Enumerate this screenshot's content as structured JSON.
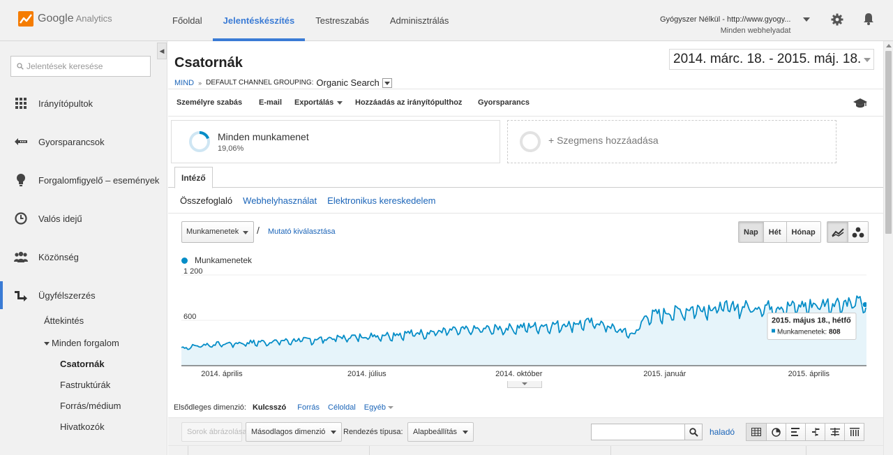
{
  "app": {
    "logo_google": "Google",
    "logo_product": "Analytics"
  },
  "nav": {
    "tabs": [
      {
        "label": "Főoldal",
        "active": false
      },
      {
        "label": "Jelentéskészítés",
        "active": true
      },
      {
        "label": "Testreszabás",
        "active": false
      },
      {
        "label": "Adminisztrálás",
        "active": false
      }
    ]
  },
  "account": {
    "property": "Gyógyszer Nélkül - http://www.gyogy...",
    "view": "Minden webhelyadat"
  },
  "sidebar": {
    "search_placeholder": "Jelentések keresése",
    "items": [
      {
        "label": "Irányítópultok",
        "icon": "grid-icon"
      },
      {
        "label": "Gyorsparancsok",
        "icon": "shortcut-arrow-icon"
      },
      {
        "label": "Forgalomfigyelő – események",
        "icon": "lightbulb-icon"
      },
      {
        "label": "Valós idejű",
        "icon": "clock-icon"
      },
      {
        "label": "Közönség",
        "icon": "people-icon"
      },
      {
        "label": "Ügyfélszerzés",
        "icon": "acquisition-arrow-icon",
        "active": true
      }
    ],
    "sub": {
      "overview": "Áttekintés",
      "all_traffic": "Minden forgalom",
      "channels": "Csatornák",
      "treemaps": "Fastruktúrák",
      "source_medium": "Forrás/médium",
      "referrals": "Hivatkozók"
    }
  },
  "report": {
    "title": "Csatornák",
    "date_range": "2014. márc. 18. - 2015. máj. 18.",
    "breadcrumb_root": "MIND",
    "breadcrumb_group": "Default Channel Grouping:",
    "breadcrumb_value": "Organic Search"
  },
  "toolbar": {
    "customize": "Személyre szabás",
    "email": "E-mail",
    "export": "Exportálás",
    "add_dashboard": "Hozzáadás az irányítópulthoz",
    "shortcut": "Gyorsparancs"
  },
  "segments": {
    "all_name": "Minden munkamenet",
    "all_value": "19,06%",
    "all_fraction": 0.1906,
    "add_label": "+ Szegmens hozzáadása"
  },
  "tabs": {
    "explorer": "Intéző",
    "subtabs": [
      "Összefoglaló",
      "Webhelyhasználat",
      "Elektronikus kereskedelem"
    ]
  },
  "controls": {
    "metric": "Munkamenetek",
    "slash": "/",
    "select_metric": "Mutató kiválasztása",
    "periods": [
      "Nap",
      "Hét",
      "Hónap"
    ]
  },
  "colors": {
    "series": "#058dc7",
    "fill": "#e6f4fa",
    "accent": "#3a7bd5"
  },
  "chart_data": {
    "type": "area",
    "legend": [
      "Munkamenetek"
    ],
    "series_name": "Munkamenetek",
    "y_ticks": [
      "1 200",
      "600"
    ],
    "ylim": [
      0,
      1200
    ],
    "x_labels": [
      "2014. április",
      "2014. július",
      "2014. október",
      "2015. január",
      "2015. április"
    ],
    "x_range": [
      "2014-03-18",
      "2015-05-18"
    ],
    "interval": "day",
    "anchors": [
      [
        "2014-03-18",
        230
      ],
      [
        "2014-04-01",
        270
      ],
      [
        "2014-05-01",
        300
      ],
      [
        "2014-06-01",
        330
      ],
      [
        "2014-07-01",
        370
      ],
      [
        "2014-08-01",
        410
      ],
      [
        "2014-09-01",
        450
      ],
      [
        "2014-10-01",
        480
      ],
      [
        "2014-11-01",
        520
      ],
      [
        "2014-12-01",
        560
      ],
      [
        "2014-12-24",
        400
      ],
      [
        "2015-01-01",
        640
      ],
      [
        "2015-02-01",
        740
      ],
      [
        "2015-03-01",
        760
      ],
      [
        "2015-04-01",
        760
      ],
      [
        "2015-05-01",
        820
      ],
      [
        "2015-05-18",
        808
      ]
    ],
    "tooltip": {
      "date": "2015. május 18., hétfő",
      "label": "Munkamenetek:",
      "value": "808"
    }
  },
  "dimensions": {
    "label": "Elsődleges dimenzió:",
    "items": [
      "Kulcsszó",
      "Forrás",
      "Céloldal",
      "Egyéb"
    ]
  },
  "table_toolbar": {
    "plot_rows": "Sorok ábrázolása",
    "secondary": "Másodlagos dimenzió",
    "sort_label": "Rendezés típusa:",
    "sort_value": "Alapbeállítás",
    "advanced": "haladó"
  }
}
